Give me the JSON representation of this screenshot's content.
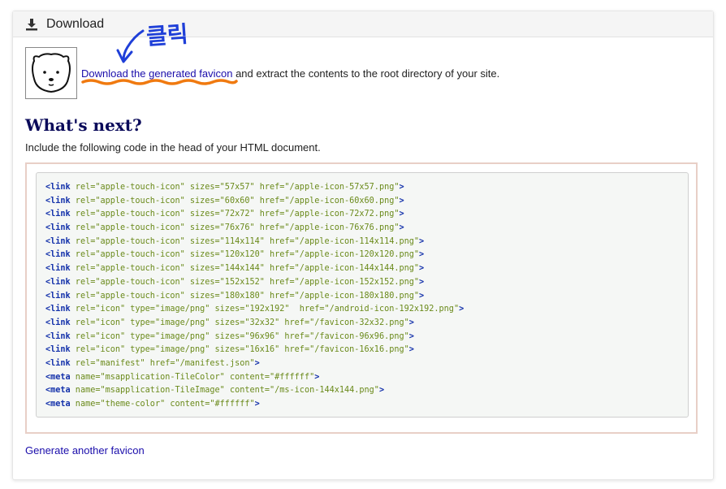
{
  "header": {
    "title": "Download",
    "icon": "download-icon"
  },
  "intro": {
    "link_text": "Download the generated favicon",
    "rest_text": " and extract the contents to the root directory of your site."
  },
  "annotation": {
    "text": "클릭",
    "color": "#1f3fd8",
    "underline_color": "#f07a10"
  },
  "section": {
    "title": "What's next?",
    "subtitle": "Include the following code in the head of your HTML document."
  },
  "code_lines": [
    "<link rel=\"apple-touch-icon\" sizes=\"57x57\" href=\"/apple-icon-57x57.png\">",
    "<link rel=\"apple-touch-icon\" sizes=\"60x60\" href=\"/apple-icon-60x60.png\">",
    "<link rel=\"apple-touch-icon\" sizes=\"72x72\" href=\"/apple-icon-72x72.png\">",
    "<link rel=\"apple-touch-icon\" sizes=\"76x76\" href=\"/apple-icon-76x76.png\">",
    "<link rel=\"apple-touch-icon\" sizes=\"114x114\" href=\"/apple-icon-114x114.png\">",
    "<link rel=\"apple-touch-icon\" sizes=\"120x120\" href=\"/apple-icon-120x120.png\">",
    "<link rel=\"apple-touch-icon\" sizes=\"144x144\" href=\"/apple-icon-144x144.png\">",
    "<link rel=\"apple-touch-icon\" sizes=\"152x152\" href=\"/apple-icon-152x152.png\">",
    "<link rel=\"apple-touch-icon\" sizes=\"180x180\" href=\"/apple-icon-180x180.png\">",
    "<link rel=\"icon\" type=\"image/png\" sizes=\"192x192\"  href=\"/android-icon-192x192.png\">",
    "<link rel=\"icon\" type=\"image/png\" sizes=\"32x32\" href=\"/favicon-32x32.png\">",
    "<link rel=\"icon\" type=\"image/png\" sizes=\"96x96\" href=\"/favicon-96x96.png\">",
    "<link rel=\"icon\" type=\"image/png\" sizes=\"16x16\" href=\"/favicon-16x16.png\">",
    "<link rel=\"manifest\" href=\"/manifest.json\">",
    "<meta name=\"msapplication-TileColor\" content=\"#ffffff\">",
    "<meta name=\"msapplication-TileImage\" content=\"/ms-icon-144x144.png\">",
    "<meta name=\"theme-color\" content=\"#ffffff\">"
  ],
  "footer": {
    "link_text": "Generate another favicon"
  },
  "colors": {
    "link": "#1a0dab",
    "heading": "#0a0a5a",
    "code_border": "#e8cfc7"
  }
}
